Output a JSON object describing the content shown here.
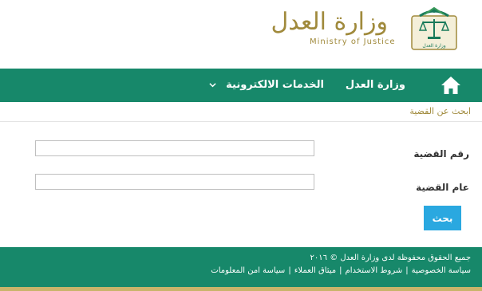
{
  "header": {
    "logo_ar": "وزارة العدل",
    "logo_en": "Ministry of Justice",
    "emblem_text": "وزارة العدل"
  },
  "nav": {
    "home_icon": "home-icon",
    "ministry_label": "وزارة العدل",
    "services_label": "الخدمات الالكترونية",
    "chevron_icon": "chevron-down-icon"
  },
  "breadcrumb": {
    "label": "ابحث عن القضية"
  },
  "form": {
    "case_number_label": "رقم القضية",
    "case_number_value": "",
    "case_year_label": "عام القضية",
    "case_year_value": "",
    "search_button_label": "بحث"
  },
  "footer": {
    "copyright": "جميع الحقوق محفوظة لدى وزارة العدل © ٢٠١٦",
    "links": [
      "سياسة الخصوصية",
      "شروط الاستخدام",
      "ميثاق العملاء",
      "سياسة امن المعلومات"
    ],
    "separator": "|"
  },
  "colors": {
    "primary_green": "#17886a",
    "gold": "#a08a3c",
    "button_blue": "#2aa8e0"
  }
}
